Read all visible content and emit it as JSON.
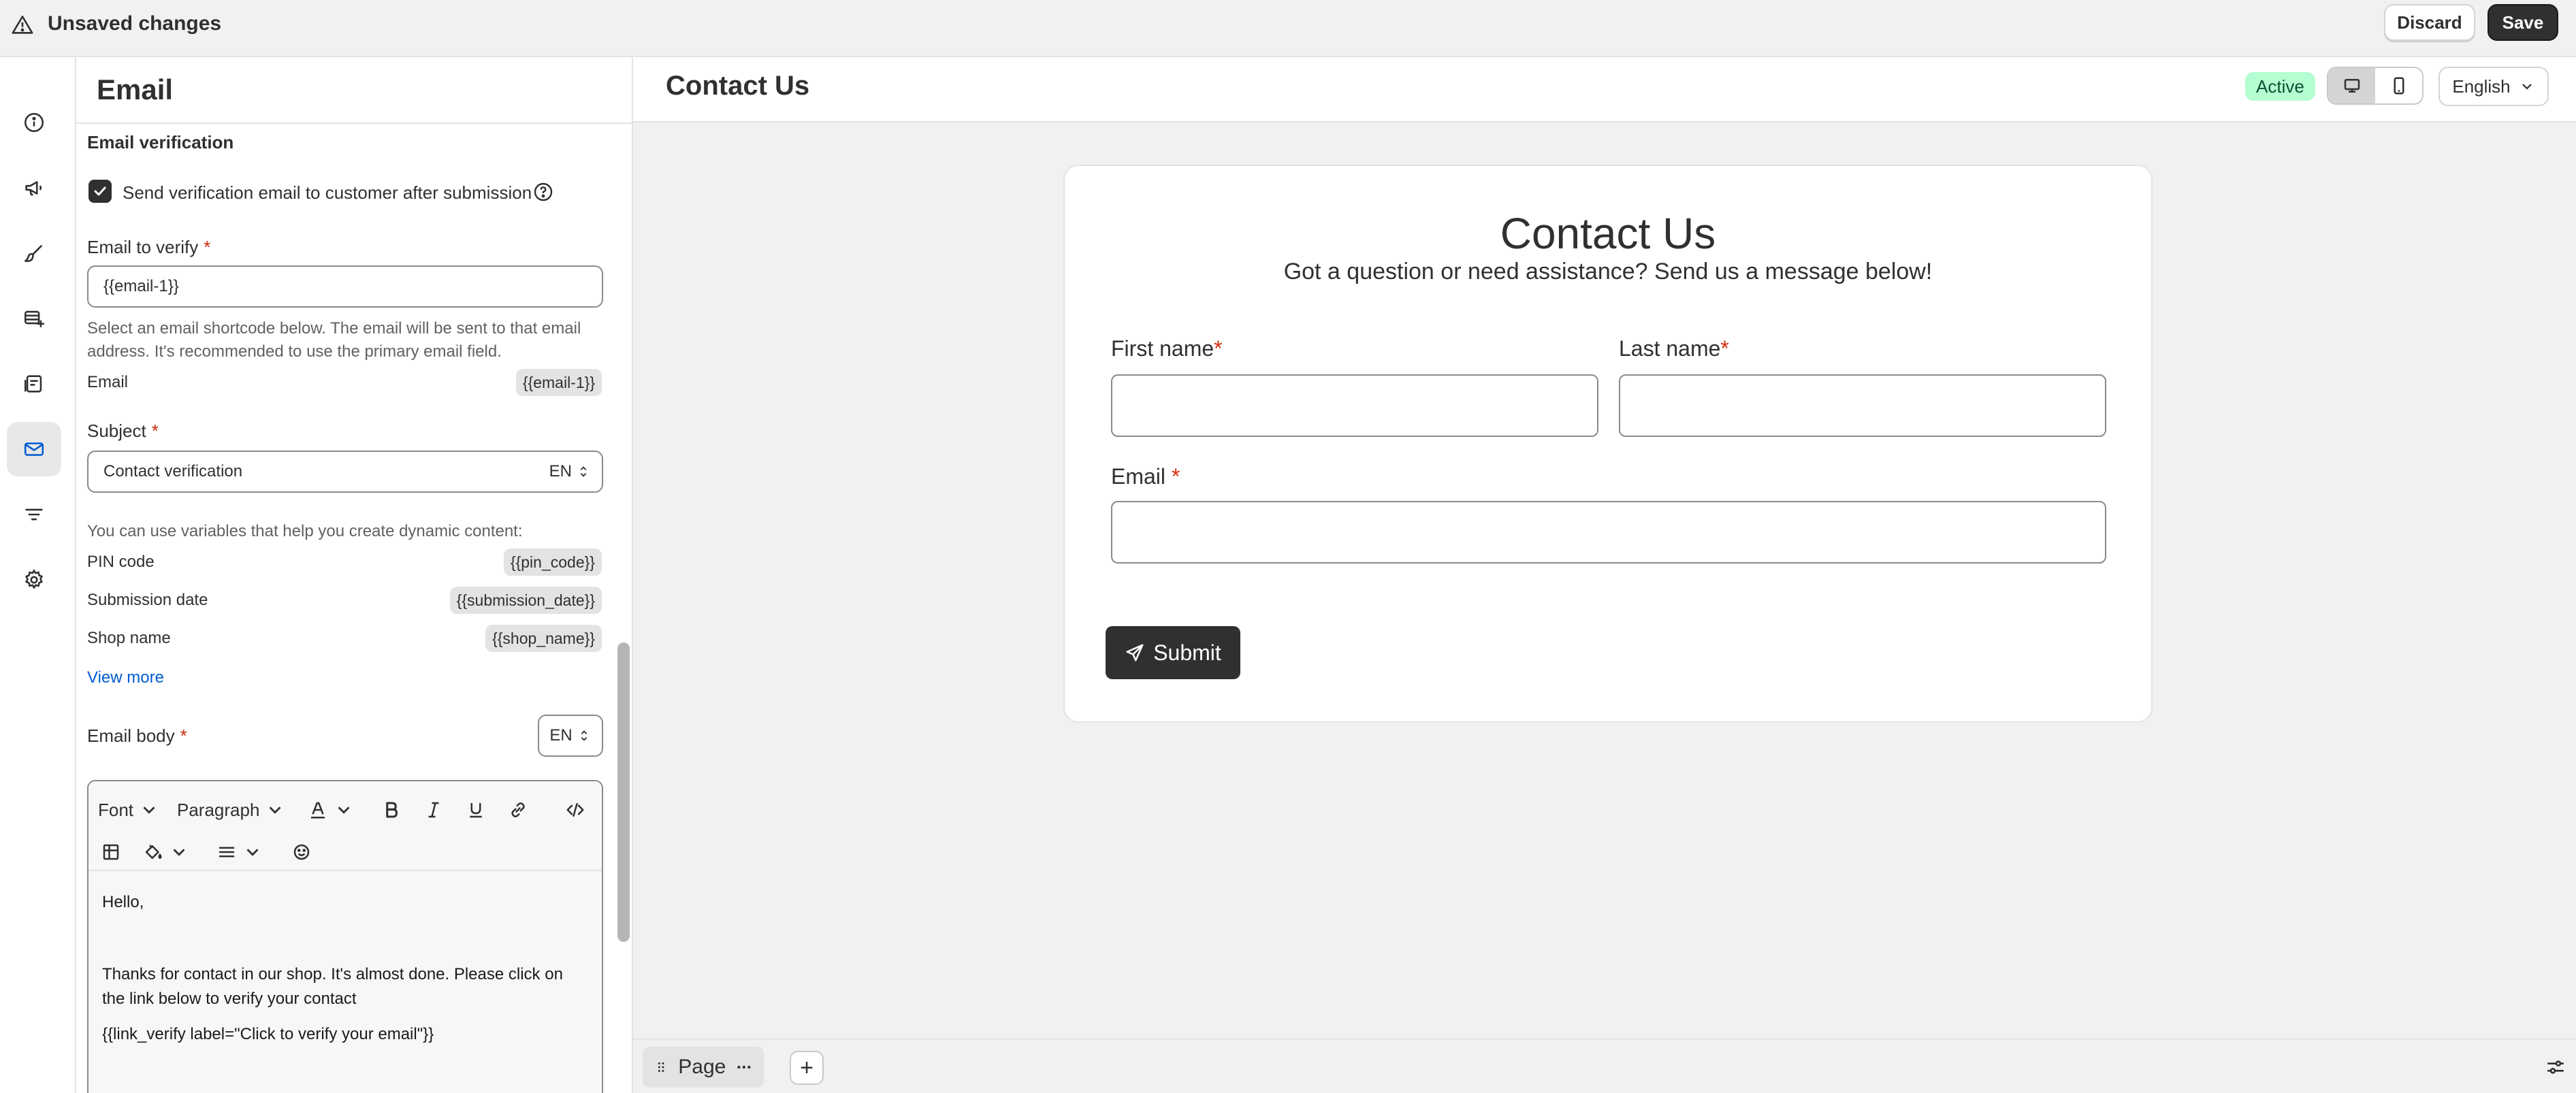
{
  "topbar": {
    "title": "Unsaved changes",
    "discard_label": "Discard",
    "save_label": "Save",
    "warn_icon": "alert-triangle-icon"
  },
  "rail": {
    "items": [
      {
        "name": "info",
        "icon": "info-icon"
      },
      {
        "name": "announcement",
        "icon": "megaphone-icon"
      },
      {
        "name": "design",
        "icon": "paintbrush-icon"
      },
      {
        "name": "submissions",
        "icon": "database-add-icon"
      },
      {
        "name": "pages",
        "icon": "form-icon"
      },
      {
        "name": "email",
        "icon": "email-icon",
        "active": true
      },
      {
        "name": "filters",
        "icon": "filter-lines-icon"
      },
      {
        "name": "settings",
        "icon": "gear-icon"
      }
    ]
  },
  "panel": {
    "title": "Email",
    "section_label": "Email verification",
    "checkbox_label": "Send verification email to customer after submission",
    "checkbox_checked": true,
    "email_to_verify": {
      "label": "Email to verify",
      "value": "{{email-1}}",
      "help": "Select an email shortcode below. The email will be sent to that email address. It's recommended to use the primary email field.",
      "shortcode_label": "Email",
      "shortcode_value": "{{email-1}}"
    },
    "subject": {
      "label": "Subject",
      "value": "Contact verification",
      "lang": "EN"
    },
    "variables": {
      "intro": "You can use variables that help you create dynamic content:",
      "rows": [
        {
          "label": "PIN code",
          "code": "{{pin_code}}"
        },
        {
          "label": "Submission date",
          "code": "{{submission_date}}"
        },
        {
          "label": "Shop name",
          "code": "{{shop_name}}"
        }
      ],
      "view_more": "View more"
    },
    "email_body": {
      "label": "Email body",
      "lang": "EN",
      "toolbar": {
        "font": "Font",
        "paragraph": "Paragraph"
      },
      "lines": [
        "Hello,",
        "",
        "Thanks for contact in our shop. It's almost done. Please click on the link below to verify your contact",
        "{{link_verify label=\"Click to verify your email\"}}"
      ]
    }
  },
  "preview": {
    "title": "Contact Us",
    "status": "Active",
    "language": "English",
    "form": {
      "title": "Contact Us",
      "subtitle": "Got a question or need assistance? Send us a message below!",
      "first_name": "First name",
      "last_name": "Last name",
      "email": "Email",
      "submit": "Submit"
    }
  },
  "bottom": {
    "page_label": "Page",
    "add_label": "+"
  }
}
